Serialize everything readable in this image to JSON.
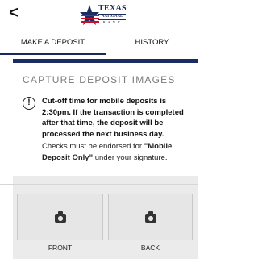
{
  "header": {
    "back_glyph": "<",
    "logo": {
      "line1": "TEXAS",
      "line2": "NATIONAL",
      "line3": "B A N K"
    }
  },
  "tabs": [
    {
      "label": "MAKE A DEPOSIT",
      "active": true
    },
    {
      "label": "HISTORY",
      "active": false
    }
  ],
  "capture": {
    "title": "CAPTURE DEPOSIT IMAGES",
    "alert_glyph": "!",
    "cutoff_text": "Cut-off time for mobile deposits is 2:30pm.  If the transaction is completed after that time, the deposit will be processed the next business day.",
    "endorse_prefix": "Checks must be endorsed for ",
    "endorse_bold": "\"Mobile Deposit Only\"",
    "endorse_suffix": " under your signature."
  },
  "images": {
    "front_label": "FRONT",
    "back_label": "BACK",
    "icon": "camera-icon"
  },
  "colors": {
    "navy": "#1b2c62",
    "flag_red": "#c8102e"
  }
}
